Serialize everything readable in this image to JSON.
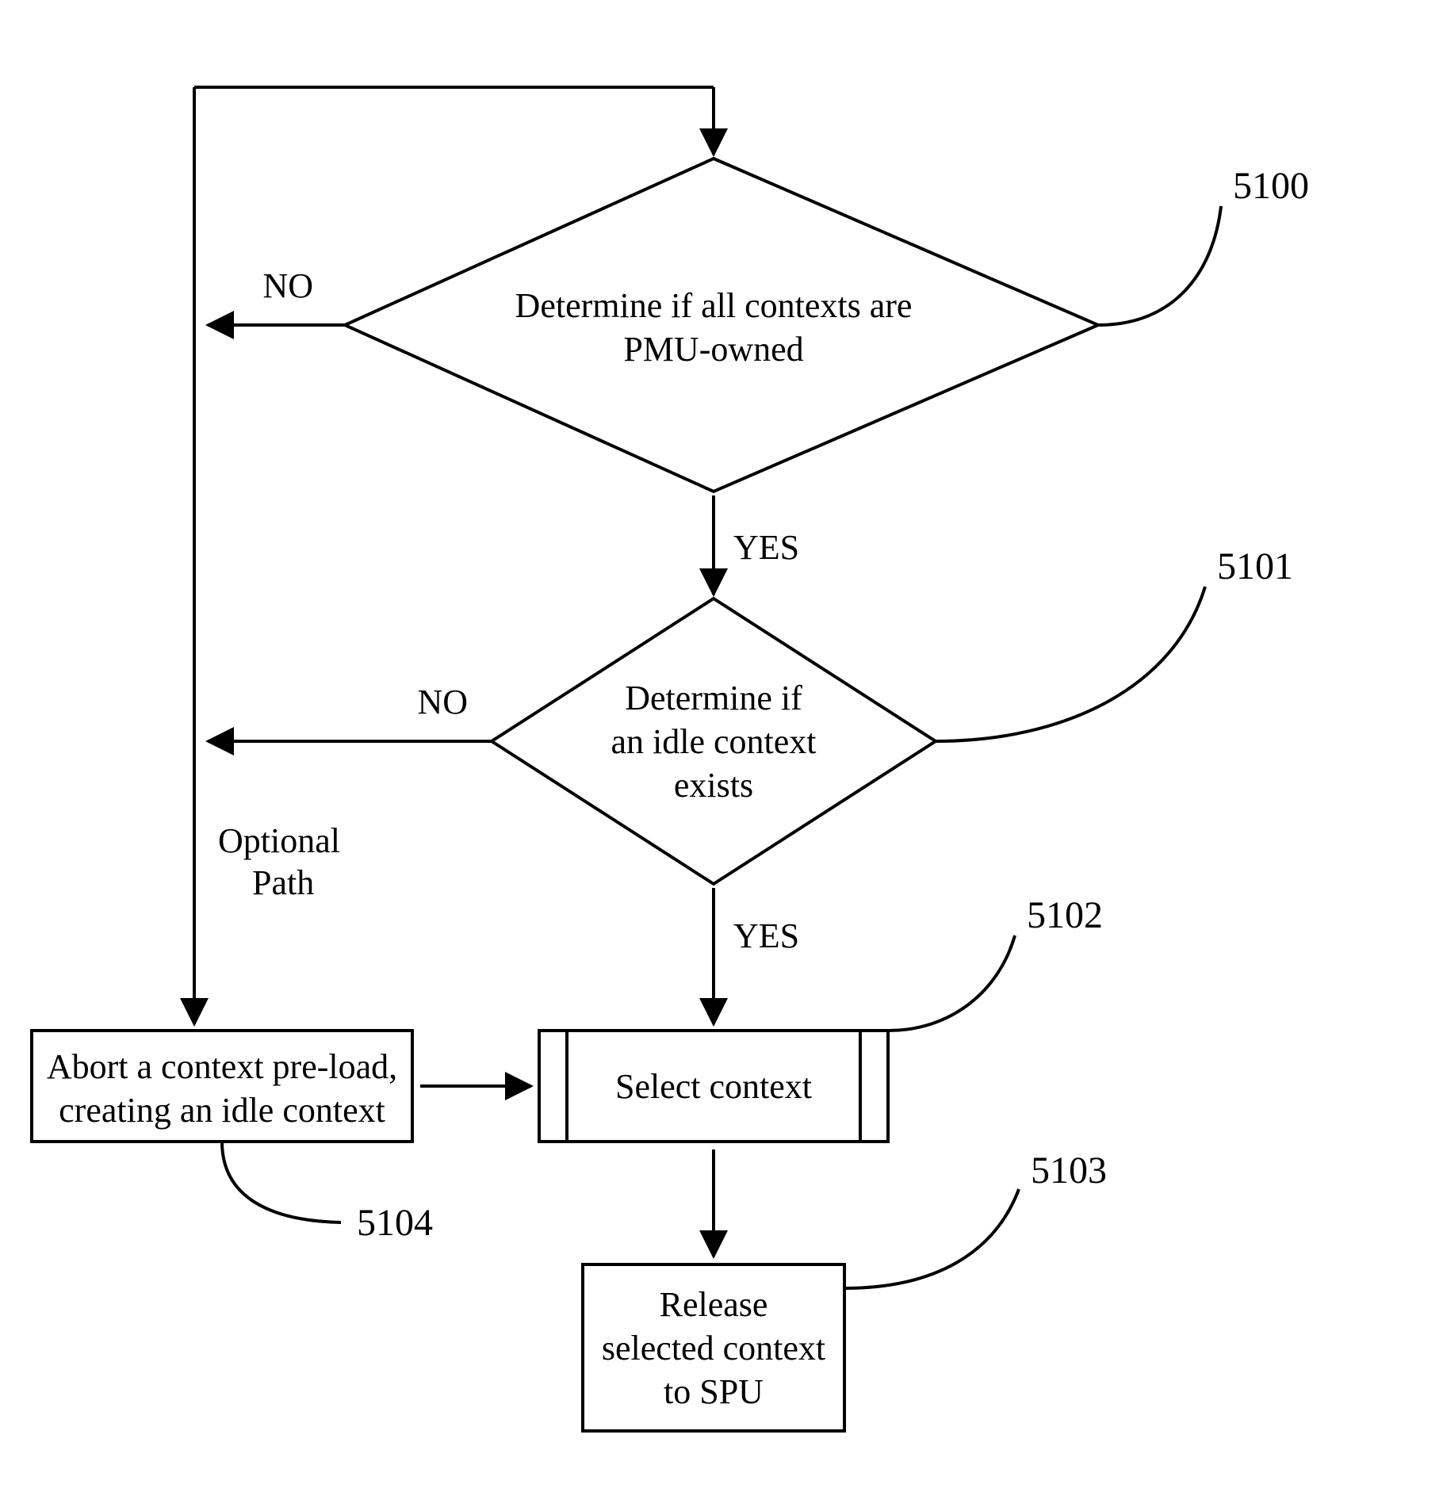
{
  "nodes": {
    "n5100": {
      "ref": "5100",
      "line1": "Determine if all contexts are",
      "line2": "PMU-owned"
    },
    "n5101": {
      "ref": "5101",
      "line1": "Determine if",
      "line2": "an idle context",
      "line3": "exists"
    },
    "n5102": {
      "ref": "5102",
      "line1": "Select context"
    },
    "n5103": {
      "ref": "5103",
      "line1": "Release",
      "line2": "selected context",
      "line3": "to SPU"
    },
    "n5104": {
      "ref": "5104",
      "line1": "Abort a context pre-load,",
      "line2": "creating an idle context"
    }
  },
  "edges": {
    "no1": "NO",
    "no2": "NO",
    "yes1": "YES",
    "yes2": "YES",
    "optional1": "Optional",
    "optional2": "Path"
  }
}
